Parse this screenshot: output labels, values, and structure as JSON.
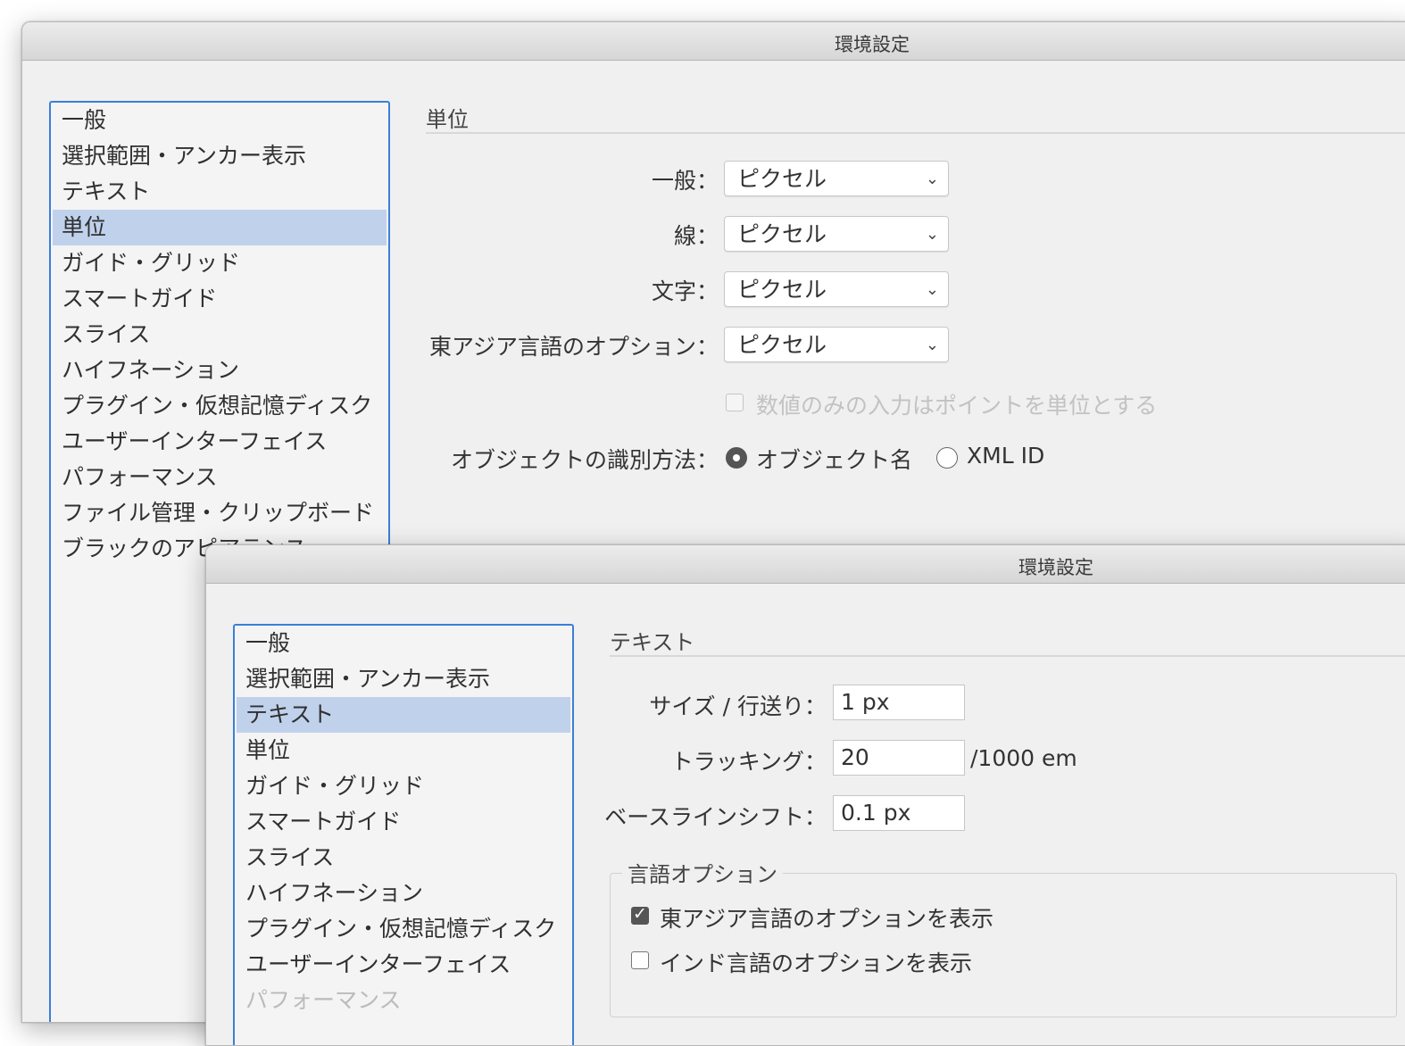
{
  "back_window": {
    "title": "環境設定",
    "categories": [
      "一般",
      "選択範囲・アンカー表示",
      "テキスト",
      "単位",
      "ガイド・グリッド",
      "スマートガイド",
      "スライス",
      "ハイフネーション",
      "プラグイン・仮想記憶ディスク",
      "ユーザーインターフェイス",
      "パフォーマンス",
      "ファイル管理・クリップボード",
      "ブラックのアピアランス"
    ],
    "section_title": "単位",
    "rows": [
      {
        "label": "一般：",
        "value": "ピクセル"
      },
      {
        "label": "線：",
        "value": "ピクセル"
      },
      {
        "label": "文字：",
        "value": "ピクセル"
      },
      {
        "label": "東アジア言語のオプション：",
        "value": "ピクセル"
      }
    ],
    "numeric_checkbox_label": "数値のみの入力はポイントを単位とする",
    "object_id_label": "オブジェクトの識別方法：",
    "radio_object_name": "オブジェクト名",
    "radio_xml_id": "XML ID",
    "chevron": "⌄"
  },
  "front_window": {
    "title": "環境設定",
    "categories": [
      "一般",
      "選択範囲・アンカー表示",
      "テキスト",
      "単位",
      "ガイド・グリッド",
      "スマートガイド",
      "スライス",
      "ハイフネーション",
      "プラグイン・仮想記憶ディスク",
      "ユーザーインターフェイス",
      "パフォーマンス"
    ],
    "section_title": "テキスト",
    "size_label": "サイズ / 行送り：",
    "size_value": "1 px",
    "tracking_label": "トラッキング：",
    "tracking_value": "20",
    "tracking_unit": "/1000 em",
    "baseline_label": "ベースラインシフト：",
    "baseline_value": "0.1 px",
    "lang_group_title": "言語オプション",
    "east_asian_label": "東アジア言語のオプションを表示",
    "indic_label": "インド言語のオプションを表示"
  }
}
